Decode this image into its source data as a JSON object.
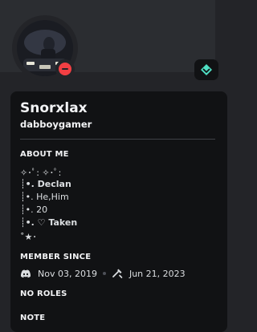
{
  "profile": {
    "display_name": "Snorxlax",
    "username": "dabboygamer",
    "status": "do-not-disturb",
    "badge": "nitro-diamond-icon"
  },
  "about_me": {
    "heading": "ABOUT ME",
    "lines": [
      "✧･ﾟ: ✧･ﾟ:",
      "┊•. Declan",
      "┊•. He,Him",
      "┊•. 20",
      "┊•. ♡ Taken",
      "˚★･"
    ]
  },
  "member_since": {
    "heading": "MEMBER SINCE",
    "discord_date": "Nov 03, 2019",
    "server_date": "Jun 21, 2023"
  },
  "roles": {
    "heading": "NO ROLES"
  },
  "note": {
    "heading": "NOTE"
  },
  "colors": {
    "background": "#232428",
    "card": "#111214",
    "dnd_status": "#f23f43",
    "nitro_badge": "#4fdfc3"
  }
}
